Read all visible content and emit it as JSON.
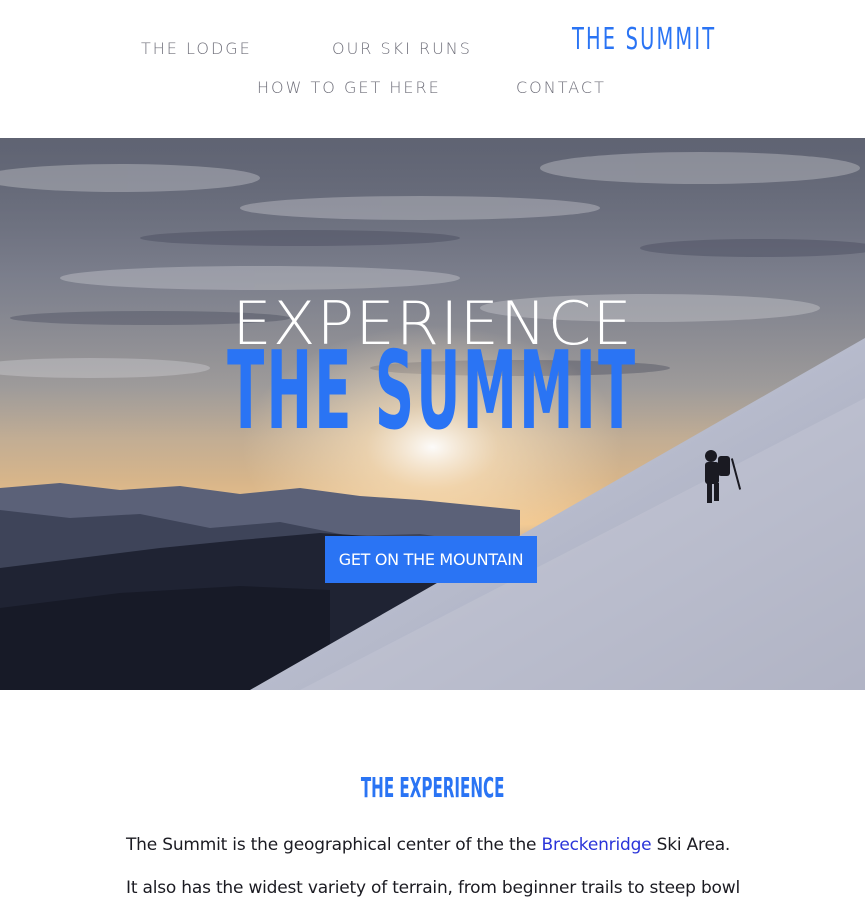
{
  "nav": {
    "items": [
      {
        "label": "THE LODGE"
      },
      {
        "label": "OUR SKI RUNS"
      },
      {
        "label": "HOW TO GET HERE"
      },
      {
        "label": "CONTACT"
      }
    ],
    "brand": "THE SUMMIT"
  },
  "hero": {
    "kicker": "EXPERIENCE",
    "title": "THE SUMMIT",
    "cta_label": "GET ON THE MOUNTAIN",
    "image_description_icon": "mountain-hiker-photo"
  },
  "experience": {
    "heading": "THE EXPERIENCE",
    "para1_before": "The Summit is the geographical center of the the ",
    "para1_link": "Breckenridge",
    "para1_after": " Ski Area.",
    "para2": "It also has the widest variety of terrain, from beginner trails to steep bowl"
  },
  "colors": {
    "accent": "#2a74f4",
    "nav_text": "#6f6f7a",
    "link": "#2a34d9"
  }
}
